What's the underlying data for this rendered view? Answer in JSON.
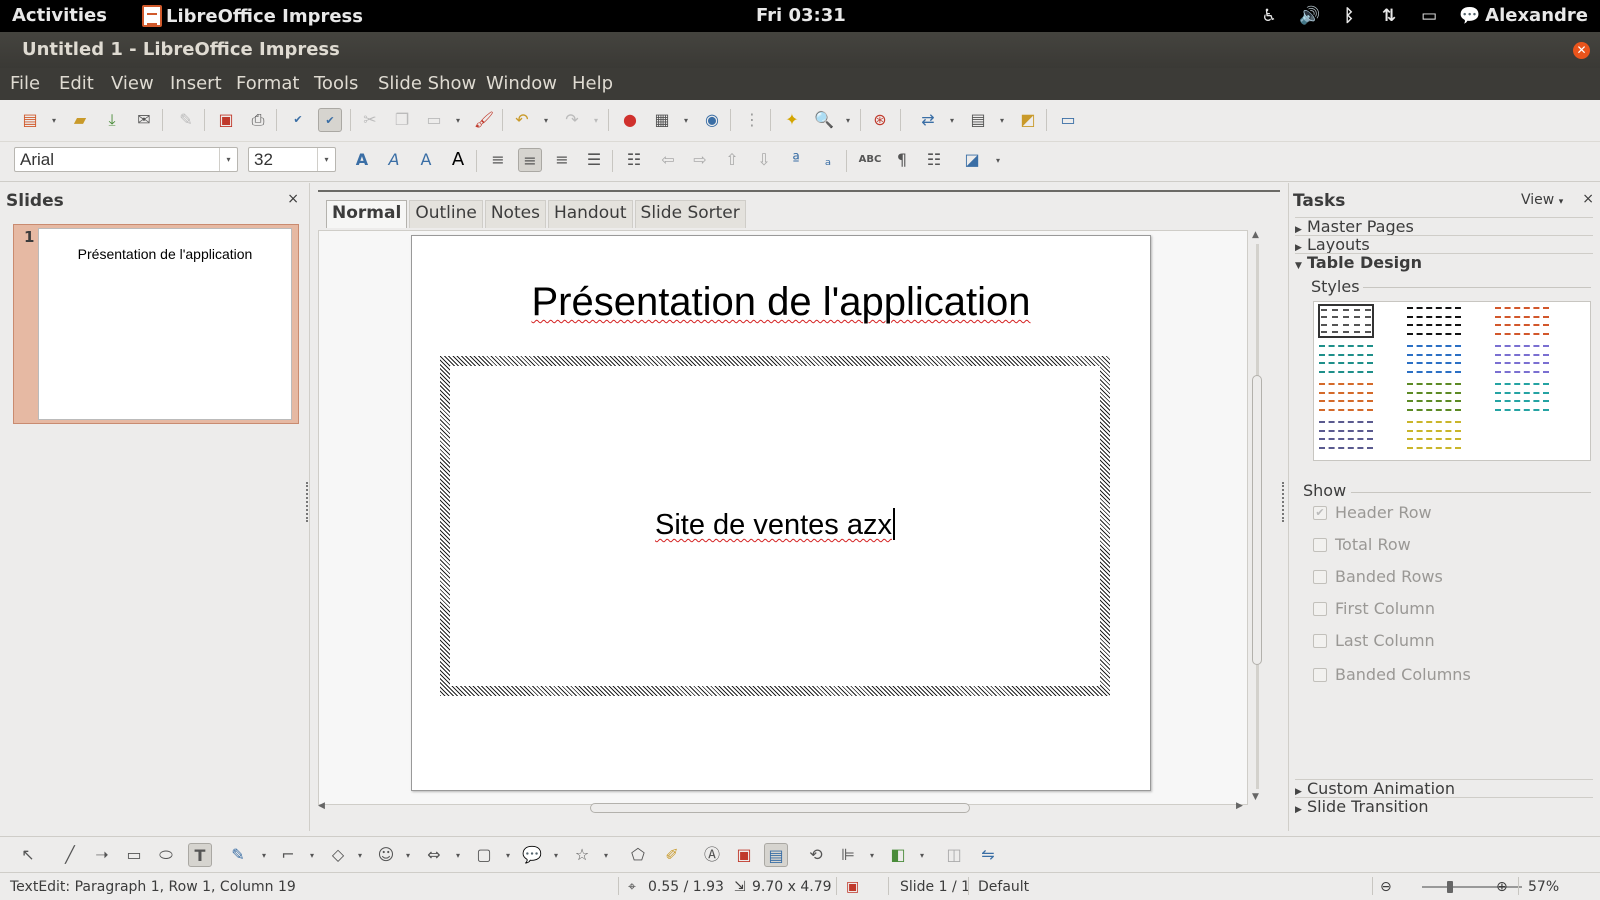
{
  "topbar": {
    "activities": "Activities",
    "app_name": "LibreOffice Impress",
    "clock": "Fri 03:31",
    "user": "Alexandre",
    "icons": [
      "accessibility-icon",
      "volume-icon",
      "bluetooth-icon",
      "network-icon",
      "battery-icon",
      "chat-icon"
    ]
  },
  "window": {
    "title": "Untitled 1 - LibreOffice Impress"
  },
  "menu": [
    "File",
    "Edit",
    "View",
    "Insert",
    "Format",
    "Tools",
    "Slide Show",
    "Window",
    "Help"
  ],
  "formatting": {
    "font_name": "Arial",
    "font_size": "32"
  },
  "slides_pane": {
    "title": "Slides",
    "close": "×",
    "slides": [
      {
        "number": "1",
        "title": "Présentation de l'application"
      }
    ]
  },
  "view_tabs": [
    "Normal",
    "Outline",
    "Notes",
    "Handout",
    "Slide Sorter"
  ],
  "slide": {
    "title": "Présentation de l'application",
    "body": "Site de ventes azx"
  },
  "tasks": {
    "title": "Tasks",
    "view_label": "View",
    "close": "×",
    "sections": {
      "master_pages": "Master Pages",
      "layouts": "Layouts",
      "table_design": "Table Design",
      "custom_animation": "Custom Animation",
      "slide_transition": "Slide Transition"
    },
    "styles_label": "Styles",
    "style_colors": [
      "#555555",
      "#111111",
      "#d2572b",
      "#1e8f8a",
      "#2a6fc4",
      "#7a6fd1",
      "#d46a2a",
      "#5c8a24",
      "#24a3a3",
      "#5a5a8f",
      "#c9b52a"
    ],
    "show_label": "Show",
    "show_options": [
      {
        "label": "Header Row",
        "checked": true
      },
      {
        "label": "Total Row",
        "checked": false
      },
      {
        "label": "Banded Rows",
        "checked": false
      },
      {
        "label": "First Column",
        "checked": false
      },
      {
        "label": "Last Column",
        "checked": false
      },
      {
        "label": "Banded Columns",
        "checked": false
      }
    ]
  },
  "status": {
    "mode": "TextEdit: Paragraph 1, Row 1, Column 19",
    "position": "0.55 / 1.93",
    "size": "9.70 x 4.79",
    "slide": "Slide 1 / 1",
    "master": "Default",
    "zoom": "57%"
  }
}
